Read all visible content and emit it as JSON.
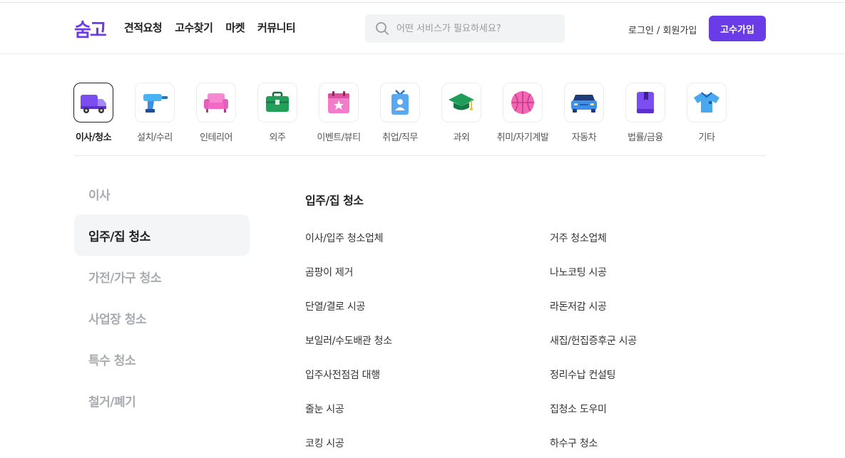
{
  "header": {
    "logo": "숨고",
    "nav": [
      "견적요청",
      "고수찾기",
      "마켓",
      "커뮤니티"
    ],
    "search_placeholder": "어떤 서비스가 필요하세요?",
    "login_label": "로그인 / 회원가입",
    "join_label": "고수가입"
  },
  "categories": [
    {
      "label": "이사/청소",
      "icon": "truck-icon",
      "active": true
    },
    {
      "label": "설치/수리",
      "icon": "drill-icon"
    },
    {
      "label": "인테리어",
      "icon": "sofa-icon"
    },
    {
      "label": "외주",
      "icon": "briefcase-icon"
    },
    {
      "label": "이벤트/뷰티",
      "icon": "calendar-star-icon"
    },
    {
      "label": "취업/직무",
      "icon": "id-badge-icon"
    },
    {
      "label": "과외",
      "icon": "graduation-cap-icon"
    },
    {
      "label": "취미/자기계발",
      "icon": "basketball-icon"
    },
    {
      "label": "자동차",
      "icon": "car-icon"
    },
    {
      "label": "법률/금융",
      "icon": "book-icon"
    },
    {
      "label": "기타",
      "icon": "shirt-icon"
    }
  ],
  "sidebar": {
    "items": [
      "이사",
      "입주/집 청소",
      "가전/가구 청소",
      "사업장 청소",
      "특수 청소",
      "철거/폐기"
    ],
    "active_index": 1
  },
  "section": {
    "title": "입주/집 청소",
    "left_items": [
      "이사/입주 청소업체",
      "곰팡이 제거",
      "단열/결로 시공",
      "보일러/수도배관 청소",
      "입주사전점검 대행",
      "줄눈 시공",
      "코킹 시공"
    ],
    "right_items": [
      "거주 청소업체",
      "나노코팅 시공",
      "라돈저감 시공",
      "새집/헌집증후군 시공",
      "정리수납 컨설팅",
      "집청소 도우미",
      "하수구 청소"
    ]
  },
  "colors": {
    "brand": "#6a3ce8",
    "active_bg": "#f4f5f7",
    "inactive_text": "#a8abb0"
  }
}
